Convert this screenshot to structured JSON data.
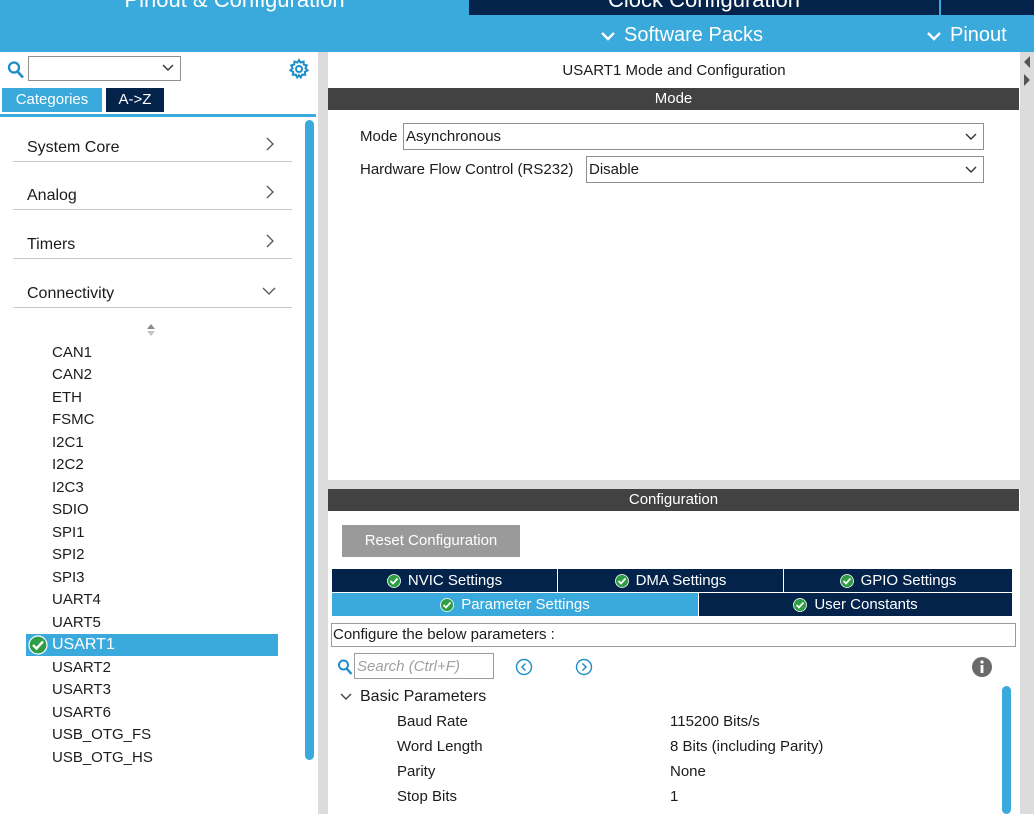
{
  "header": {
    "tabs": [
      {
        "label": "Pinout & Configuration"
      },
      {
        "label": "Clock Configuration"
      },
      {
        "label": ""
      }
    ],
    "menus": [
      {
        "label": "Software Packs"
      },
      {
        "label": "Pinout"
      }
    ]
  },
  "sidebar": {
    "search_value": "",
    "tabs": [
      {
        "label": "Categories"
      },
      {
        "label": "A->Z"
      }
    ],
    "categories": [
      {
        "label": "System Core"
      },
      {
        "label": "Analog"
      },
      {
        "label": "Timers"
      },
      {
        "label": "Connectivity"
      }
    ],
    "peripherals": [
      "CAN1",
      "CAN2",
      "ETH",
      "FSMC",
      "I2C1",
      "I2C2",
      "I2C3",
      "SDIO",
      "SPI1",
      "SPI2",
      "SPI3",
      "UART4",
      "UART5",
      "USART1",
      "USART2",
      "USART3",
      "USART6",
      "USB_OTG_FS",
      "USB_OTG_HS"
    ],
    "selected_peripheral": "USART1"
  },
  "main": {
    "title": "USART1 Mode and Configuration",
    "mode_section": "Mode",
    "mode_label": "Mode",
    "mode_value": "Asynchronous",
    "flow_label": "Hardware Flow Control (RS232)",
    "flow_value": "Disable",
    "config_section": "Configuration",
    "reset_label": "Reset Configuration",
    "tabs": [
      {
        "label": "NVIC Settings"
      },
      {
        "label": "DMA Settings"
      },
      {
        "label": "GPIO Settings"
      },
      {
        "label": "Parameter Settings"
      },
      {
        "label": "User Constants"
      }
    ],
    "configure_text": "Configure the below parameters :",
    "search_placeholder": "Search (Ctrl+F)",
    "group_label": "Basic Parameters",
    "params": [
      {
        "name": "Baud Rate",
        "value": "115200 Bits/s"
      },
      {
        "name": "Word Length",
        "value": "8 Bits (including Parity)"
      },
      {
        "name": "Parity",
        "value": "None"
      },
      {
        "name": "Stop Bits",
        "value": "1"
      }
    ]
  },
  "colors": {
    "accent": "#3aaadc",
    "navy": "#03234b",
    "section_bar": "#424242",
    "check_green": "#2e9e44"
  }
}
